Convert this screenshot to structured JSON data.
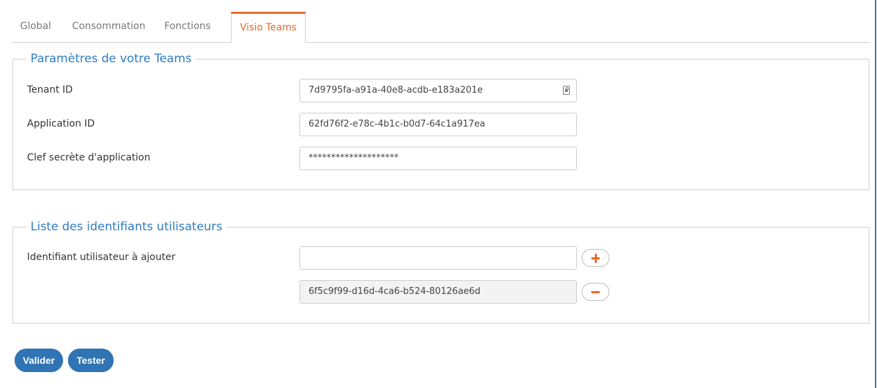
{
  "tabs": [
    {
      "label": "Global",
      "active": false
    },
    {
      "label": "Consommation",
      "active": false
    },
    {
      "label": "Fonctions",
      "active": false
    },
    {
      "label": "Visio Teams",
      "active": true
    }
  ],
  "teams_params": {
    "legend": "Paramètres de votre Teams",
    "tenant_id_label": "Tenant ID",
    "tenant_id_value": "7d9795fa-a91a-40e8-acdb-e183a201e",
    "application_id_label": "Application ID",
    "application_id_value": "62fd76f2-e78c-4b1c-b0d7-64c1a917ea",
    "secret_label": "Clef secrète d'application",
    "secret_value": "********************"
  },
  "user_ids": {
    "legend": "Liste des identifiants utilisateurs",
    "add_label": "Identifiant utilisateur à ajouter",
    "add_value": "",
    "entries": [
      "6f5c9f99-d16d-4ca6-b524-80126ae6d"
    ]
  },
  "actions": {
    "valider_label": "Valider",
    "tester_label": "Tester"
  },
  "colors": {
    "accent": "#e8692a",
    "primary": "#3074b4",
    "legend": "#2f7cc4"
  },
  "icons": {
    "tenant_field_icon": "contact-card-icon",
    "add_button_icon": "plus-icon",
    "remove_button_icon": "minus-icon"
  }
}
